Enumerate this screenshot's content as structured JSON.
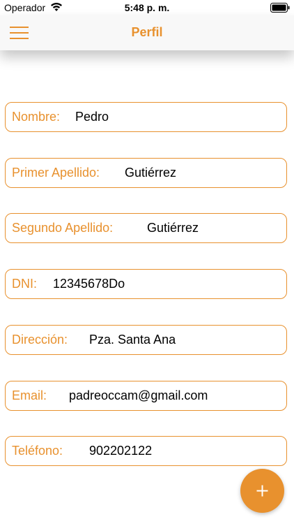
{
  "status_bar": {
    "carrier": "Operador",
    "time": "5:48 p. m.",
    "wifi_icon": "wifi-icon",
    "battery_icon": "battery-icon"
  },
  "nav": {
    "title": "Perfil",
    "menu_icon": "hamburger-menu-icon"
  },
  "fields": {
    "nombre": {
      "label": "Nombre:",
      "value": "Pedro"
    },
    "primer_apellido": {
      "label": "Primer Apellido:",
      "value": "Gutiérrez"
    },
    "segundo_apellido": {
      "label": "Segundo Apellido:",
      "value": "Gutiérrez"
    },
    "dni": {
      "label": "DNI:",
      "value": "12345678Do"
    },
    "direccion": {
      "label": "Dirección:",
      "value": "Pza. Santa Ana"
    },
    "email": {
      "label": "Email:",
      "value": "padreoccam@gmail.com"
    },
    "telefono": {
      "label": "Teléfono:",
      "value": "902202122"
    }
  },
  "fab": {
    "icon": "plus-icon",
    "label": "+"
  },
  "colors": {
    "accent": "#e8912e",
    "nav_background": "#f8f8f8",
    "background": "#ffffff",
    "text": "#000000"
  }
}
